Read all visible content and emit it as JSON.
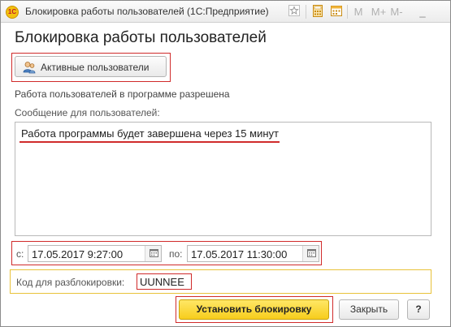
{
  "window": {
    "title": "Блокировка работы пользователей  (1С:Предприятие)",
    "app_icon_text": "1С",
    "toolbar_icons": [
      "favorite-star-icon",
      "calculator-icon",
      "calendar-icon",
      "memory-m-icon",
      "memory-m-plus-icon",
      "memory-m-minus-icon",
      "minimize-icon"
    ]
  },
  "form": {
    "title": "Блокировка работы пользователей",
    "active_users_label": "Активные пользователи",
    "status_text": "Работа пользователей в программе разрешена",
    "message_label": "Сообщение для пользователей:",
    "message_value": "Работа программы будет завершена через 15 минут",
    "from_label": "с:",
    "from_value": "17.05.2017  9:27:00",
    "to_label": "по:",
    "to_value": "17.05.2017 11:30:00",
    "unlock_code_label": "Код для разблокировки:",
    "unlock_code_value": "UUNNEE"
  },
  "buttons": {
    "set_lock": "Установить блокировку",
    "close": "Закрыть",
    "help": "?"
  },
  "toolbar_glyphs": {
    "m": "M",
    "m_plus": "M+",
    "m_minus": "M-",
    "minimize": "_"
  },
  "colors": {
    "highlight_red": "#d02b2b",
    "highlight_yellow": "#e8c23a",
    "primary_button": "#f7cd1c"
  }
}
